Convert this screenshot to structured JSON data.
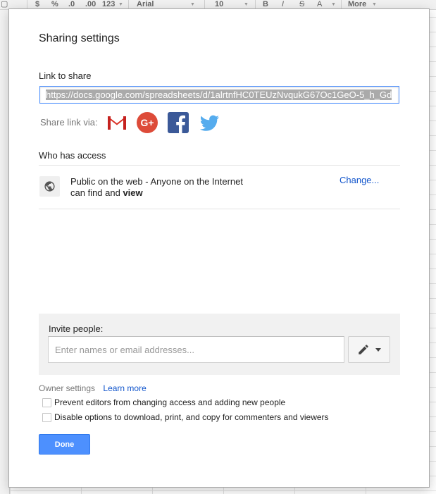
{
  "toolbar": {
    "currency": "$",
    "percent": "%",
    "decimal_decrease": ".0",
    "decimal_increase": ".00",
    "number_format": "123",
    "font": "Arial",
    "font_size": "10",
    "bold": "B",
    "italic": "I",
    "strike": "S",
    "text_color": "A",
    "more": "More"
  },
  "dialog": {
    "title": "Sharing settings",
    "link_label": "Link to share",
    "link_url": "https://docs.google.com/spreadsheets/d/1alrtnfHC0TEUzNvqukG67Oc1GeO-5_h_Gd",
    "share_via_label": "Share link via:",
    "share_icons": [
      "gmail-icon",
      "google-plus-icon",
      "facebook-icon",
      "twitter-icon"
    ],
    "who_has_access_label": "Who has access",
    "access": {
      "line1": "Public on the web - Anyone on the Internet",
      "line2_prefix": "can find and ",
      "line2_bold": "view",
      "change_label": "Change..."
    },
    "invite": {
      "label": "Invite people:",
      "placeholder": "Enter names or email addresses...",
      "permission_icon": "pencil-icon"
    },
    "owner_settings": {
      "label": "Owner settings",
      "learn_more": "Learn more",
      "option1": "Prevent editors from changing access and adding new people",
      "option2": "Disable options to download, print, and copy for commenters and viewers",
      "option1_checked": false,
      "option2_checked": false
    },
    "done_label": "Done"
  },
  "colors": {
    "accent_blue": "#4d90fe",
    "link_blue": "#1155cc",
    "facebook": "#3b5998",
    "twitter": "#55acee",
    "google_plus": "#dd4b39"
  }
}
